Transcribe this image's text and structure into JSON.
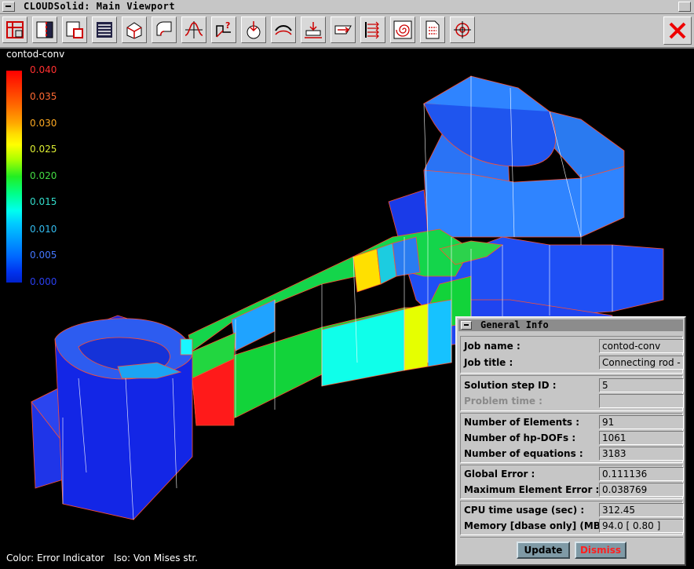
{
  "window": {
    "title": "CLOUDSolid: Main Viewport"
  },
  "toolbar": {
    "tools": [
      "mesh-grid-icon",
      "section-view-icon",
      "window-view-icon",
      "layers-list-icon",
      "3d-box-icon",
      "curved-surface-icon",
      "curve-plot-icon",
      "query-point-icon",
      "point-load-icon",
      "distributed-load-icon",
      "support-icon",
      "edge-load-icon",
      "load-arrows-icon",
      "spiral-icon",
      "document-icon",
      "target-icon"
    ],
    "close_icon": "close-icon"
  },
  "legend": {
    "title": "contod-conv",
    "ticks": [
      {
        "label": "0.040",
        "color": "#ff2020"
      },
      {
        "label": "0.035",
        "color": "#ff6633"
      },
      {
        "label": "0.030",
        "color": "#ffaa22"
      },
      {
        "label": "0.025",
        "color": "#ddee33"
      },
      {
        "label": "0.020",
        "color": "#44dd44"
      },
      {
        "label": "0.015",
        "color": "#33ddcc"
      },
      {
        "label": "0.010",
        "color": "#33bbee"
      },
      {
        "label": "0.005",
        "color": "#4477ff"
      },
      {
        "label": "0.000",
        "color": "#2233ee"
      }
    ],
    "scale_colors": [
      "#ff0000",
      "#ff2a00",
      "#ff5500",
      "#ff8800",
      "#ffaa00",
      "#ffd000",
      "#f0ff00",
      "#aaff00",
      "#44ff22",
      "#00ee44",
      "#00ff99",
      "#00ffdd",
      "#00ddff",
      "#00aaff",
      "#0088ff",
      "#0066ff",
      "#0044ff",
      "#0022ee"
    ]
  },
  "caption": {
    "color_text": "Color: Error Indicator",
    "iso_text": "Iso: Von Mises str."
  },
  "info": {
    "title": "General Info",
    "groups": [
      {
        "rows": [
          {
            "label": "Job name :",
            "value": "contod-conv"
          },
          {
            "label": "Job title :",
            "value": "Connecting rod -"
          }
        ]
      },
      {
        "rows": [
          {
            "label": "Solution step ID :",
            "value": "5"
          },
          {
            "label": "Problem time :",
            "value": "",
            "dim": true
          }
        ]
      },
      {
        "rows": [
          {
            "label": "Number of Elements :",
            "value": "91"
          },
          {
            "label": "Number of hp-DOFs :",
            "value": "1061"
          },
          {
            "label": "Number of equations :",
            "value": "3183"
          }
        ]
      },
      {
        "rows": [
          {
            "label": "Global Error :",
            "value": "0.111136"
          },
          {
            "label": "Maximum Element Error :",
            "value": "0.038769"
          }
        ]
      },
      {
        "rows": [
          {
            "label": "CPU time usage (sec) :",
            "value": "312.45"
          },
          {
            "label": "Memory [dbase only] (MB) :",
            "value": "94.0 [ 0.80 ]"
          }
        ]
      }
    ],
    "update_label": "Update",
    "dismiss_label": "Dismiss"
  }
}
